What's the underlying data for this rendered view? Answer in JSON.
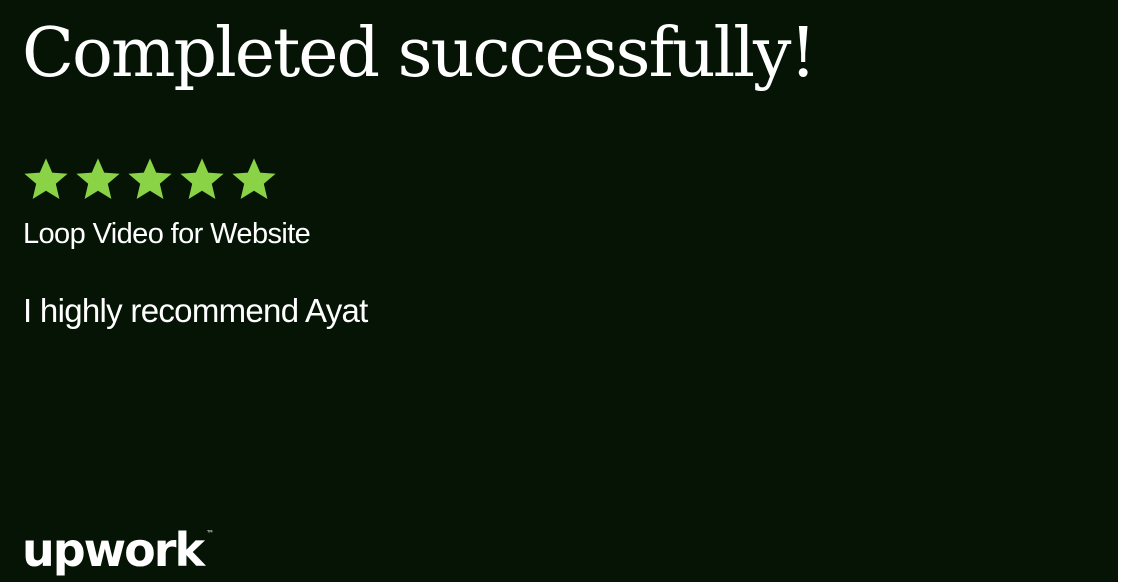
{
  "card": {
    "title": "Completed successfully!",
    "rating": {
      "stars": 5,
      "out_of": 5,
      "star_color": "#8bd346",
      "icon": "star-icon"
    },
    "project_title": "Loop Video for Website",
    "review_text": "I highly recommend Ayat",
    "logo": {
      "text": "upwork",
      "trademark": "™"
    },
    "background_color": "#051405"
  }
}
